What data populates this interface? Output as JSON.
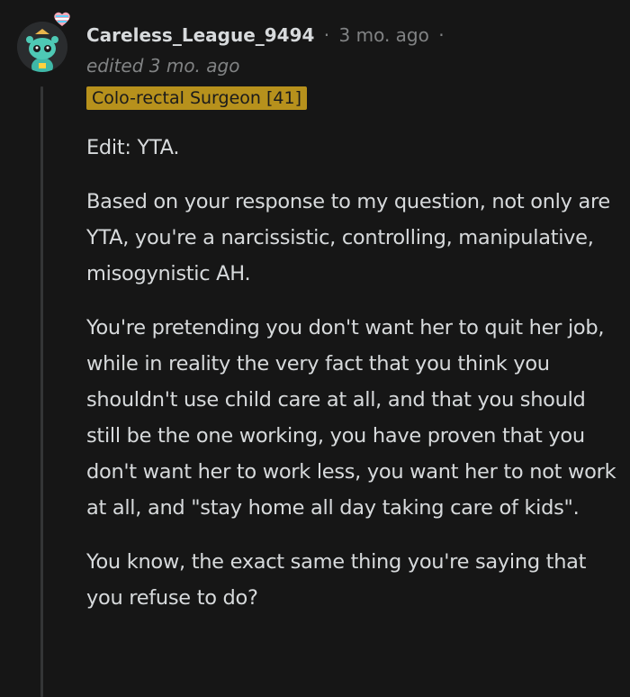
{
  "comment": {
    "username": "Careless_League_9494",
    "separator": "·",
    "timestamp": "3 mo. ago",
    "edited": "edited 3 mo. ago",
    "flair": "Colo-rectal Surgeon [41]",
    "avatar_icon": "snoo-avatar-icon",
    "badge_icon": "heart-badge-icon",
    "paragraphs": [
      "Edit: YTA.",
      "Based on your response to my question, not only are YTA, you're a narcissistic, controlling, manipulative, misogynistic AH.",
      "You're pretending you don't want her to quit her job, while in reality the very fact that you think you shouldn't use child care at all, and that you should still be the one working, you have proven that you don't want her to work less, you want her to not work at all, and \"stay home all day taking care of kids\".",
      "You know, the exact same thing you're saying that you refuse to do?"
    ]
  },
  "colors": {
    "background": "#161616",
    "flair_bg": "#b7911c",
    "text": "#d7dadc",
    "meta": "#818384"
  }
}
